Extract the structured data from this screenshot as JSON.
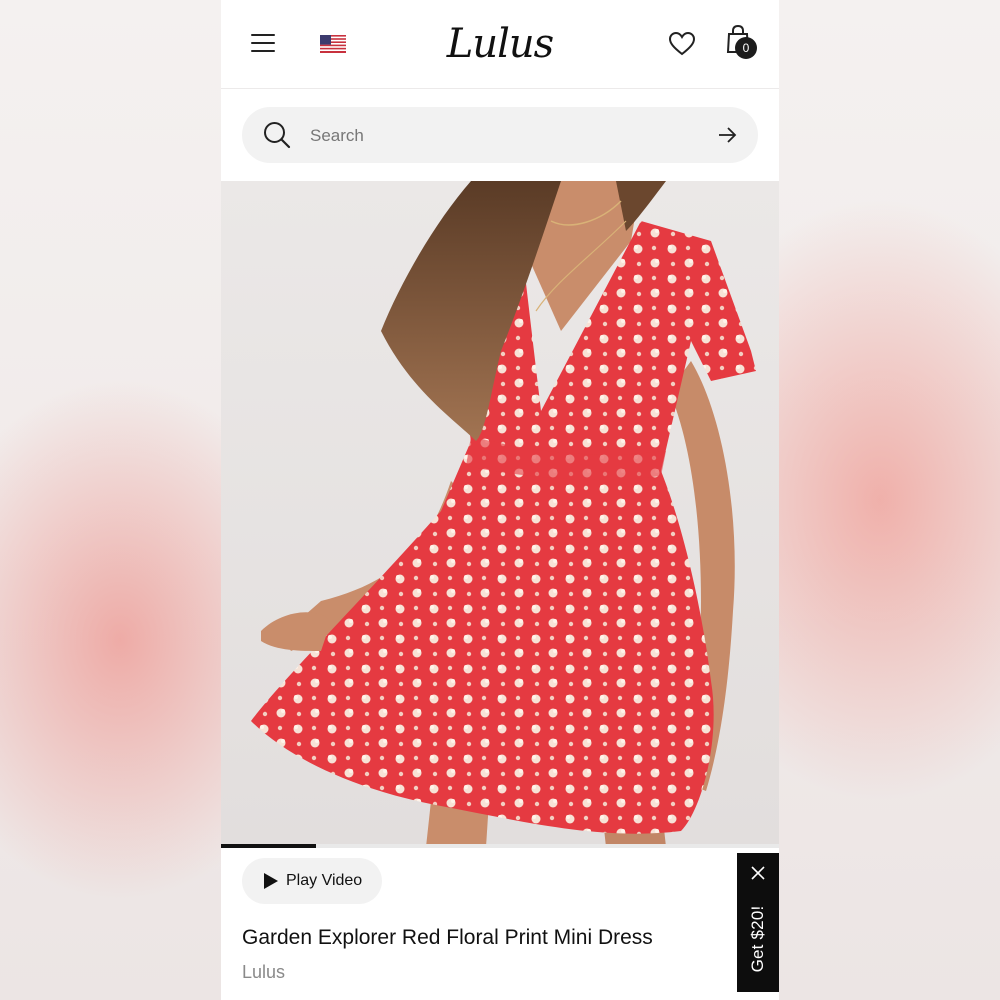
{
  "header": {
    "logo": "Lulus",
    "cart_count": "0"
  },
  "search": {
    "placeholder": "Search"
  },
  "product": {
    "image_count_progress": 0.17,
    "play_video_label": "Play Video",
    "title": "Garden Explorer Red Floral Print Mini Dress",
    "brand": "Lulus"
  },
  "promo": {
    "label": "Get $20!"
  },
  "colors": {
    "dress_red": "#e53a41",
    "text_dark": "#111111",
    "text_muted": "#8a8a8a",
    "pill_bg": "#f2f2f2"
  },
  "icons": [
    "menu-icon",
    "us-flag-icon",
    "heart-icon",
    "shopping-bag-icon",
    "search-icon",
    "arrow-right-icon",
    "play-icon",
    "close-icon"
  ]
}
